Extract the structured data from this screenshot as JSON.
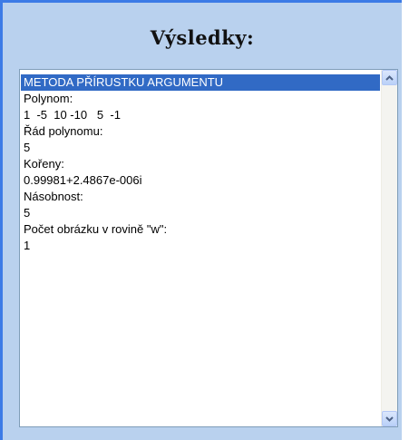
{
  "panel": {
    "title": "Výsledky:"
  },
  "results": {
    "lines": [
      "METODA PŘÍRUSTKU ARGUMENTU",
      "Polynom:",
      "1  -5  10 -10   5  -1",
      "Řád polynomu:",
      "5",
      "Kořeny:",
      "0.99981+2.4867e-006i",
      "Násobnost:",
      "5",
      "Počet obrázku v rovině \"w\":",
      "1"
    ],
    "selected_index": 0
  },
  "scrollbar": {
    "up_icon": "chevron-up-icon",
    "down_icon": "chevron-down-icon",
    "accent": "#316ac5",
    "arrow_color": "#4d6185"
  }
}
